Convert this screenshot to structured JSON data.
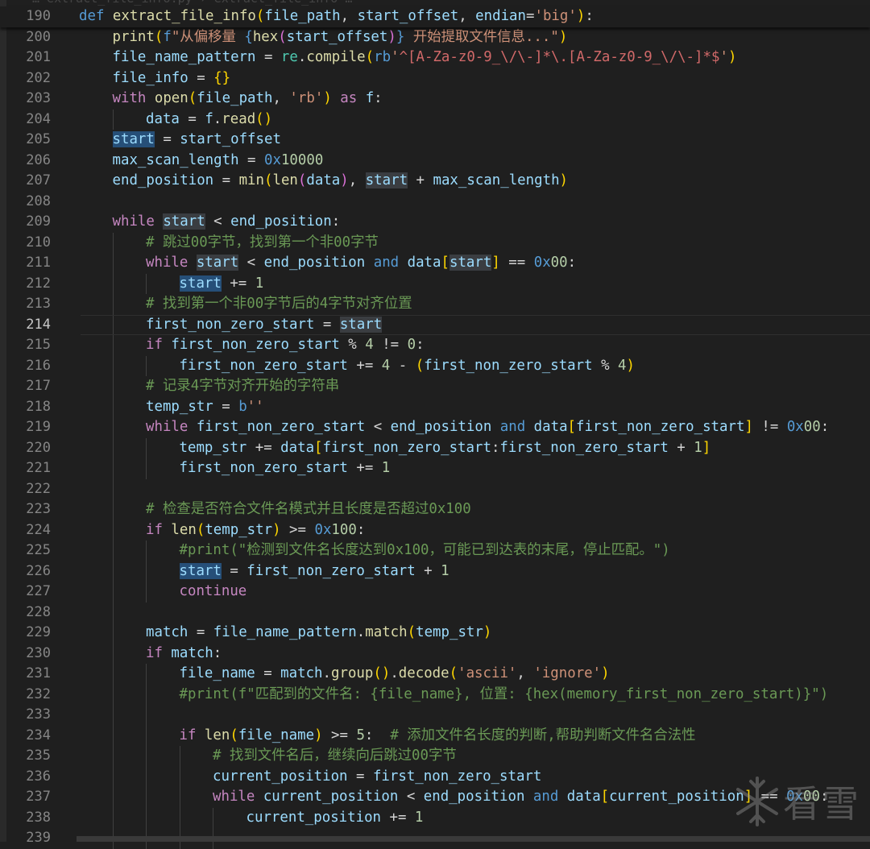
{
  "editor": {
    "language": "python",
    "current_line": 214,
    "top_strip_text": "… extract_file_info.py › extract_file_info …",
    "watermark": {
      "icon": "snowflake-icon",
      "text": "看雪"
    },
    "lines": [
      {
        "n": "190",
        "indent": 0,
        "sticky": true,
        "tokens": [
          [
            "kw",
            "def "
          ],
          [
            "fn",
            "extract_file_info"
          ],
          [
            "br1",
            "("
          ],
          [
            "var",
            "file_path"
          ],
          [
            "op",
            ", "
          ],
          [
            "var",
            "start_offset"
          ],
          [
            "op",
            ", "
          ],
          [
            "var",
            "endian"
          ],
          [
            "op",
            "="
          ],
          [
            "str",
            "'big'"
          ],
          [
            "br1",
            ")"
          ],
          [
            "op",
            ":"
          ]
        ]
      },
      {
        "n": "200",
        "indent": 1,
        "tokens": [
          [
            "fn",
            "print"
          ],
          [
            "br1",
            "("
          ],
          [
            "kw",
            "f"
          ],
          [
            "str",
            "\"从偏移量 "
          ],
          [
            "kw",
            "{"
          ],
          [
            "fn",
            "hex"
          ],
          [
            "br2",
            "("
          ],
          [
            "var",
            "start_offset"
          ],
          [
            "br2",
            ")"
          ],
          [
            "kw",
            "}"
          ],
          [
            "str",
            " 开始提取文件信息...\""
          ],
          [
            "br1",
            ")"
          ]
        ]
      },
      {
        "n": "201",
        "indent": 1,
        "tokens": [
          [
            "var",
            "file_name_pattern"
          ],
          [
            "op",
            " = "
          ],
          [
            "mod",
            "re"
          ],
          [
            "op",
            "."
          ],
          [
            "fn",
            "compile"
          ],
          [
            "br1",
            "("
          ],
          [
            "kw",
            "rb"
          ],
          [
            "str",
            "'"
          ],
          [
            "re",
            "^[A-Za-z0-9_\\/\\-]*\\.[A-Za-z0-9_\\/\\-]*$"
          ],
          [
            "str",
            "'"
          ],
          [
            "br1",
            ")"
          ]
        ]
      },
      {
        "n": "202",
        "indent": 1,
        "tokens": [
          [
            "var",
            "file_info"
          ],
          [
            "op",
            " = "
          ],
          [
            "br1",
            "{}"
          ]
        ]
      },
      {
        "n": "203",
        "indent": 1,
        "tokens": [
          [
            "ctl",
            "with "
          ],
          [
            "fn",
            "open"
          ],
          [
            "br1",
            "("
          ],
          [
            "var",
            "file_path"
          ],
          [
            "op",
            ", "
          ],
          [
            "str",
            "'rb'"
          ],
          [
            "br1",
            ")"
          ],
          [
            "ctl",
            " as "
          ],
          [
            "var",
            "f"
          ],
          [
            "op",
            ":"
          ]
        ]
      },
      {
        "n": "204",
        "indent": 2,
        "tokens": [
          [
            "var",
            "data"
          ],
          [
            "op",
            " = "
          ],
          [
            "var",
            "f"
          ],
          [
            "op",
            "."
          ],
          [
            "fn",
            "read"
          ],
          [
            "br1",
            "()"
          ]
        ]
      },
      {
        "n": "205",
        "indent": 1,
        "tokens": [
          [
            "var hl-sel",
            "start"
          ],
          [
            "op",
            " = "
          ],
          [
            "var",
            "start_offset"
          ]
        ]
      },
      {
        "n": "206",
        "indent": 1,
        "tokens": [
          [
            "var",
            "max_scan_length"
          ],
          [
            "op",
            " = "
          ],
          [
            "hex",
            "0x"
          ],
          [
            "num",
            "10000"
          ]
        ]
      },
      {
        "n": "207",
        "indent": 1,
        "tokens": [
          [
            "var",
            "end_position"
          ],
          [
            "op",
            " = "
          ],
          [
            "fn",
            "min"
          ],
          [
            "br1",
            "("
          ],
          [
            "fn",
            "len"
          ],
          [
            "br2",
            "("
          ],
          [
            "var",
            "data"
          ],
          [
            "br2",
            ")"
          ],
          [
            "op",
            ", "
          ],
          [
            "var hl-occ",
            "start"
          ],
          [
            "op",
            " + "
          ],
          [
            "var",
            "max_scan_length"
          ],
          [
            "br1",
            ")"
          ]
        ]
      },
      {
        "n": "208",
        "indent": 1,
        "tokens": []
      },
      {
        "n": "209",
        "indent": 1,
        "tokens": [
          [
            "ctl",
            "while "
          ],
          [
            "var hl-occ",
            "start"
          ],
          [
            "op",
            " < "
          ],
          [
            "var",
            "end_position"
          ],
          [
            "op",
            ":"
          ]
        ]
      },
      {
        "n": "210",
        "indent": 2,
        "tokens": [
          [
            "cm",
            "# 跳过00字节，找到第一个非00字节"
          ]
        ]
      },
      {
        "n": "211",
        "indent": 2,
        "tokens": [
          [
            "ctl",
            "while "
          ],
          [
            "var hl-occ",
            "start"
          ],
          [
            "op",
            " < "
          ],
          [
            "var",
            "end_position"
          ],
          [
            "kw",
            " and "
          ],
          [
            "var",
            "data"
          ],
          [
            "br1",
            "["
          ],
          [
            "var hl-occ",
            "start"
          ],
          [
            "br1",
            "]"
          ],
          [
            "op",
            " == "
          ],
          [
            "hex",
            "0x"
          ],
          [
            "num",
            "00"
          ],
          [
            "op",
            ":"
          ]
        ]
      },
      {
        "n": "212",
        "indent": 3,
        "tokens": [
          [
            "var hl-sel",
            "start"
          ],
          [
            "op",
            " += "
          ],
          [
            "num",
            "1"
          ]
        ]
      },
      {
        "n": "213",
        "indent": 2,
        "tokens": [
          [
            "cm",
            "# 找到第一个非00字节后的4字节对齐位置"
          ]
        ]
      },
      {
        "n": "214",
        "indent": 2,
        "current": true,
        "tokens": [
          [
            "var",
            "first_non_zero_start"
          ],
          [
            "op",
            " = "
          ],
          [
            "var hl-occ",
            "start"
          ]
        ]
      },
      {
        "n": "215",
        "indent": 2,
        "tokens": [
          [
            "ctl",
            "if "
          ],
          [
            "var",
            "first_non_zero_start"
          ],
          [
            "op",
            " % "
          ],
          [
            "num",
            "4"
          ],
          [
            "op",
            " != "
          ],
          [
            "num",
            "0"
          ],
          [
            "op",
            ":"
          ]
        ]
      },
      {
        "n": "216",
        "indent": 3,
        "tokens": [
          [
            "var",
            "first_non_zero_start"
          ],
          [
            "op",
            " += "
          ],
          [
            "num",
            "4"
          ],
          [
            "op",
            " - "
          ],
          [
            "br1",
            "("
          ],
          [
            "var",
            "first_non_zero_start"
          ],
          [
            "op",
            " % "
          ],
          [
            "num",
            "4"
          ],
          [
            "br1",
            ")"
          ]
        ]
      },
      {
        "n": "217",
        "indent": 2,
        "tokens": [
          [
            "cm",
            "# 记录4字节对齐开始的字符串"
          ]
        ]
      },
      {
        "n": "218",
        "indent": 2,
        "tokens": [
          [
            "var",
            "temp_str"
          ],
          [
            "op",
            " = "
          ],
          [
            "kw",
            "b"
          ],
          [
            "str",
            "''"
          ]
        ]
      },
      {
        "n": "219",
        "indent": 2,
        "tokens": [
          [
            "ctl",
            "while "
          ],
          [
            "var",
            "first_non_zero_start"
          ],
          [
            "op",
            " < "
          ],
          [
            "var",
            "end_position"
          ],
          [
            "kw",
            " and "
          ],
          [
            "var",
            "data"
          ],
          [
            "br1",
            "["
          ],
          [
            "var",
            "first_non_zero_start"
          ],
          [
            "br1",
            "]"
          ],
          [
            "op",
            " != "
          ],
          [
            "hex",
            "0x"
          ],
          [
            "num",
            "00"
          ],
          [
            "op",
            ":"
          ]
        ]
      },
      {
        "n": "220",
        "indent": 3,
        "tokens": [
          [
            "var",
            "temp_str"
          ],
          [
            "op",
            " += "
          ],
          [
            "var",
            "data"
          ],
          [
            "br1",
            "["
          ],
          [
            "var",
            "first_non_zero_start"
          ],
          [
            "op",
            ":"
          ],
          [
            "var",
            "first_non_zero_start"
          ],
          [
            "op",
            " + "
          ],
          [
            "num",
            "1"
          ],
          [
            "br1",
            "]"
          ]
        ]
      },
      {
        "n": "221",
        "indent": 3,
        "tokens": [
          [
            "var",
            "first_non_zero_start"
          ],
          [
            "op",
            " += "
          ],
          [
            "num",
            "1"
          ]
        ]
      },
      {
        "n": "222",
        "indent": 2,
        "tokens": []
      },
      {
        "n": "223",
        "indent": 2,
        "tokens": [
          [
            "cm",
            "# 检查是否符合文件名模式并且长度是否超过0x100"
          ]
        ]
      },
      {
        "n": "224",
        "indent": 2,
        "tokens": [
          [
            "ctl",
            "if "
          ],
          [
            "fn",
            "len"
          ],
          [
            "br1",
            "("
          ],
          [
            "var",
            "temp_str"
          ],
          [
            "br1",
            ")"
          ],
          [
            "op",
            " >= "
          ],
          [
            "hex",
            "0x"
          ],
          [
            "num",
            "100"
          ],
          [
            "op",
            ":"
          ]
        ]
      },
      {
        "n": "225",
        "indent": 3,
        "tokens": [
          [
            "cm",
            "#print(\"检测到文件名长度达到0x100，可能已到达表的末尾，停止匹配。\")"
          ]
        ]
      },
      {
        "n": "226",
        "indent": 3,
        "tokens": [
          [
            "var hl-sel",
            "start"
          ],
          [
            "op",
            " = "
          ],
          [
            "var",
            "first_non_zero_start"
          ],
          [
            "op",
            " + "
          ],
          [
            "num",
            "1"
          ]
        ]
      },
      {
        "n": "227",
        "indent": 3,
        "tokens": [
          [
            "ctl",
            "continue"
          ]
        ]
      },
      {
        "n": "228",
        "indent": 2,
        "tokens": []
      },
      {
        "n": "229",
        "indent": 2,
        "tokens": [
          [
            "var",
            "match"
          ],
          [
            "op",
            " = "
          ],
          [
            "var",
            "file_name_pattern"
          ],
          [
            "op",
            "."
          ],
          [
            "fn",
            "match"
          ],
          [
            "br1",
            "("
          ],
          [
            "var",
            "temp_str"
          ],
          [
            "br1",
            ")"
          ]
        ]
      },
      {
        "n": "230",
        "indent": 2,
        "tokens": [
          [
            "ctl",
            "if "
          ],
          [
            "var",
            "match"
          ],
          [
            "op",
            ":"
          ]
        ]
      },
      {
        "n": "231",
        "indent": 3,
        "tokens": [
          [
            "var",
            "file_name"
          ],
          [
            "op",
            " = "
          ],
          [
            "var",
            "match"
          ],
          [
            "op",
            "."
          ],
          [
            "fn",
            "group"
          ],
          [
            "br1",
            "()"
          ],
          [
            "op",
            "."
          ],
          [
            "fn",
            "decode"
          ],
          [
            "br1",
            "("
          ],
          [
            "str",
            "'ascii'"
          ],
          [
            "op",
            ", "
          ],
          [
            "str",
            "'ignore'"
          ],
          [
            "br1",
            ")"
          ]
        ]
      },
      {
        "n": "232",
        "indent": 3,
        "tokens": [
          [
            "cm",
            "#print(f\"匹配到的文件名: {file_name}, 位置: {hex(memory_first_non_zero_start)}\")"
          ]
        ]
      },
      {
        "n": "233",
        "indent": 3,
        "tokens": []
      },
      {
        "n": "234",
        "indent": 3,
        "tokens": [
          [
            "ctl",
            "if "
          ],
          [
            "fn",
            "len"
          ],
          [
            "br1",
            "("
          ],
          [
            "var",
            "file_name"
          ],
          [
            "br1",
            ")"
          ],
          [
            "op",
            " >= "
          ],
          [
            "num",
            "5"
          ],
          [
            "op",
            ":  "
          ],
          [
            "cm",
            "# 添加文件名长度的判断,帮助判断文件名合法性"
          ]
        ]
      },
      {
        "n": "235",
        "indent": 4,
        "tokens": [
          [
            "cm",
            "# 找到文件名后，继续向后跳过00字节"
          ]
        ]
      },
      {
        "n": "236",
        "indent": 4,
        "tokens": [
          [
            "var",
            "current_position"
          ],
          [
            "op",
            " = "
          ],
          [
            "var",
            "first_non_zero_start"
          ]
        ]
      },
      {
        "n": "237",
        "indent": 4,
        "tokens": [
          [
            "ctl",
            "while "
          ],
          [
            "var",
            "current_position"
          ],
          [
            "op",
            " < "
          ],
          [
            "var",
            "end_position"
          ],
          [
            "kw",
            " and "
          ],
          [
            "var",
            "data"
          ],
          [
            "br1",
            "["
          ],
          [
            "var",
            "current_position"
          ],
          [
            "br1",
            "]"
          ],
          [
            "op",
            " == "
          ],
          [
            "hex",
            "0x"
          ],
          [
            "num",
            "00"
          ],
          [
            "op",
            ":"
          ]
        ]
      },
      {
        "n": "238",
        "indent": 5,
        "tokens": [
          [
            "var",
            "current_position"
          ],
          [
            "op",
            " += "
          ],
          [
            "num",
            "1"
          ]
        ]
      },
      {
        "n": "239",
        "indent": 5,
        "tokens": []
      }
    ]
  }
}
